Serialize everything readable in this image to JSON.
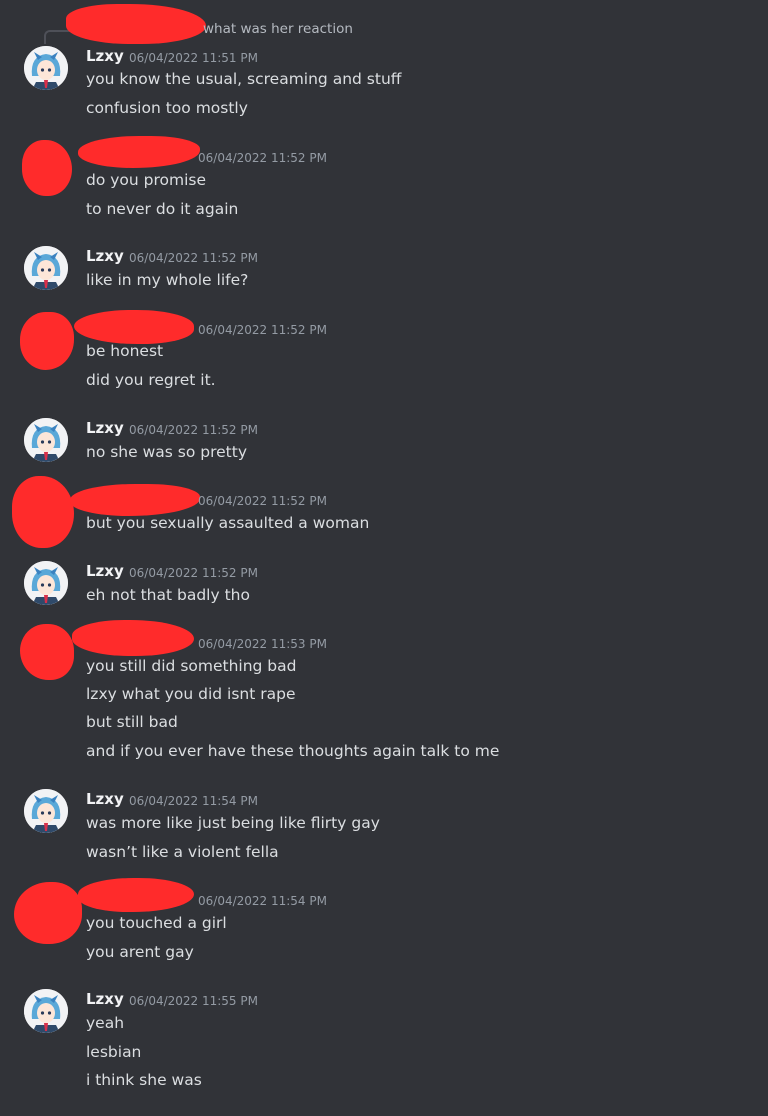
{
  "reply": {
    "text": "what was her reaction"
  },
  "colors": {
    "background": "#313338",
    "redaction": "#ff2b2b",
    "text": "#dbdee1",
    "timestamp": "#949ba4"
  },
  "avatar_icon": "anime-character-avatar",
  "messages": [
    {
      "author": "Lzxy",
      "timestamp": "06/04/2022 11:51 PM",
      "lines": [
        "you know the usual, screaming and stuff",
        "confusion too mostly"
      ]
    },
    {
      "author": "",
      "timestamp": "06/04/2022 11:52 PM",
      "lines": [
        "do you promise",
        "to never do it again"
      ]
    },
    {
      "author": "Lzxy",
      "timestamp": "06/04/2022 11:52 PM",
      "lines": [
        "like in my whole life?"
      ]
    },
    {
      "author": "",
      "timestamp": "06/04/2022 11:52 PM",
      "lines": [
        "be honest",
        "did you regret it."
      ]
    },
    {
      "author": "Lzxy",
      "timestamp": "06/04/2022 11:52 PM",
      "lines": [
        "no she was so pretty"
      ]
    },
    {
      "author": "",
      "timestamp": "06/04/2022 11:52 PM",
      "lines": [
        "but you sexually assaulted a woman"
      ]
    },
    {
      "author": "Lzxy",
      "timestamp": "06/04/2022 11:52 PM",
      "lines": [
        "eh not that badly tho"
      ]
    },
    {
      "author": "",
      "timestamp": "06/04/2022 11:53 PM",
      "lines": [
        "you still did something bad",
        "lzxy what you did isnt rape",
        "but still bad",
        "and if you ever have these thoughts again talk to me"
      ]
    },
    {
      "author": "Lzxy",
      "timestamp": "06/04/2022 11:54 PM",
      "lines": [
        "was more like just being like flirty gay",
        "wasn’t like a violent fella"
      ]
    },
    {
      "author": "",
      "timestamp": "06/04/2022 11:54 PM",
      "lines": [
        "you touched a girl",
        "you arent gay"
      ]
    },
    {
      "author": "Lzxy",
      "timestamp": "06/04/2022 11:55 PM",
      "lines": [
        "yeah",
        "lesbian",
        "i think she was"
      ]
    }
  ]
}
